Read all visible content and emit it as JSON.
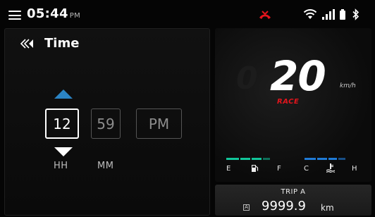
{
  "status_bar": {
    "time": "05:44",
    "ampm": "PM",
    "icons": [
      "menu-icon",
      "phone-call-end-icon",
      "wifi-icon",
      "signal-bars-icon",
      "battery-icon",
      "bluetooth-icon"
    ],
    "phone_icon_color": "#e3141c"
  },
  "time_panel": {
    "title": "Time",
    "hour": "12",
    "minute": "59",
    "period": "PM",
    "hour_label": "HH",
    "minute_label": "MM",
    "accent_color": "#2b84c4"
  },
  "speedometer": {
    "speed": "20",
    "unit": "km/h",
    "mode": "RACE",
    "mode_color": "#e3141c",
    "fuel_empty": "E",
    "fuel_full": "F",
    "temp_cold": "C",
    "temp_hot": "H",
    "fuel_color": "#11c69a",
    "temp_color": "#1f7ad6"
  },
  "trip": {
    "title": "TRIP A",
    "icon_letter": "A",
    "value": "9999.9",
    "unit": "km"
  }
}
